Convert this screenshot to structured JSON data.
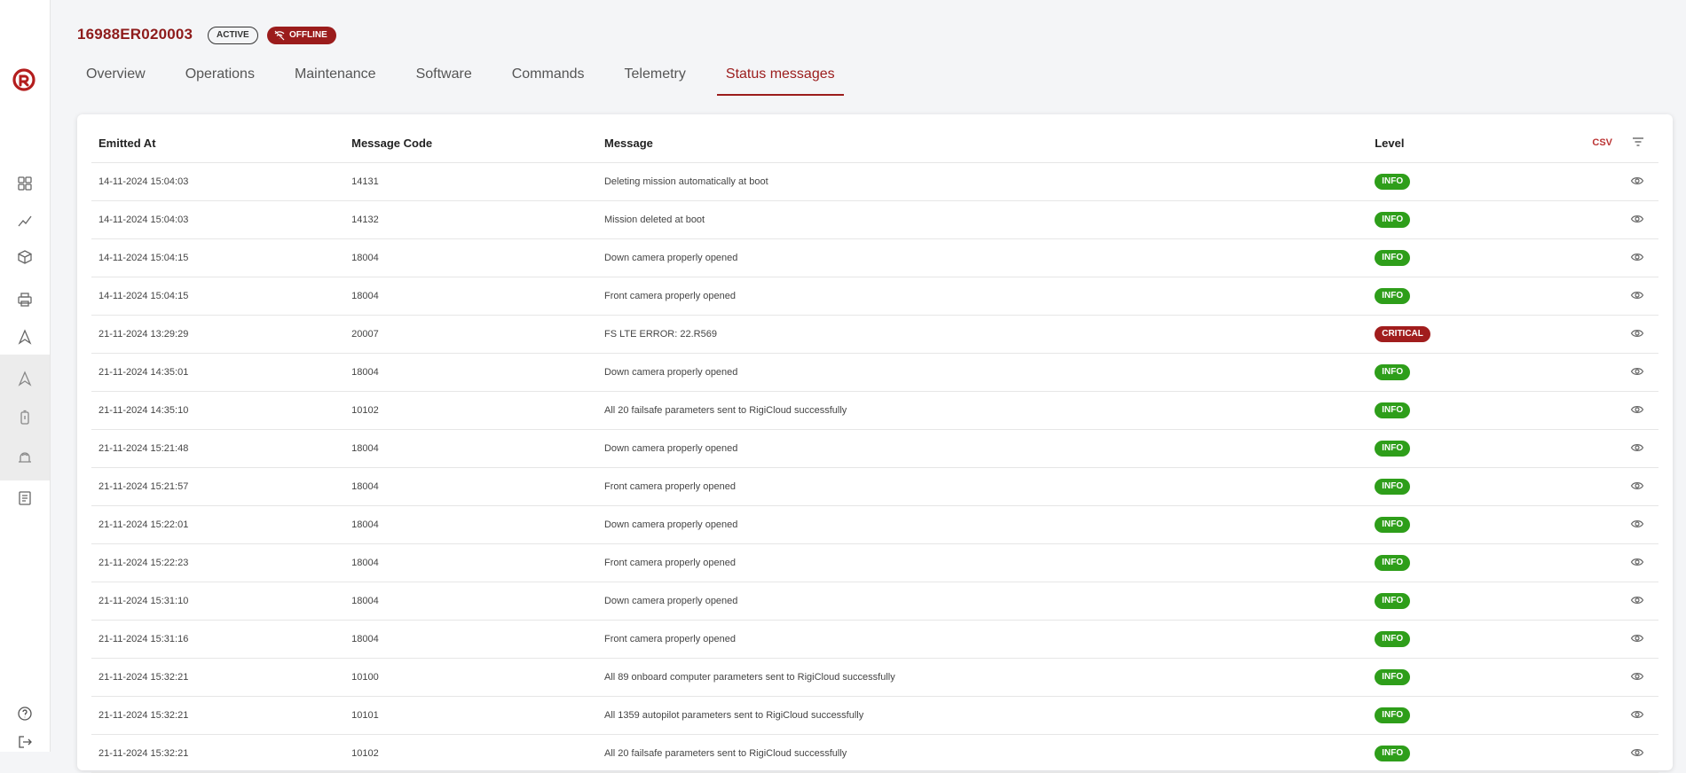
{
  "device": {
    "id": "16988ER020003",
    "status_badge": "ACTIVE",
    "connection_badge": "OFFLINE"
  },
  "tabs": [
    {
      "label": "Overview",
      "active": false
    },
    {
      "label": "Operations",
      "active": false
    },
    {
      "label": "Maintenance",
      "active": false
    },
    {
      "label": "Software",
      "active": false
    },
    {
      "label": "Commands",
      "active": false
    },
    {
      "label": "Telemetry",
      "active": false
    },
    {
      "label": "Status messages",
      "active": true
    }
  ],
  "table": {
    "columns": {
      "emitted_at": "Emitted At",
      "message_code": "Message Code",
      "message": "Message",
      "level": "Level",
      "csv": "CSV"
    },
    "rows": [
      {
        "at": "14-11-2024 15:04:03",
        "code": "14131",
        "msg": "Deleting mission automatically at boot",
        "level": "INFO"
      },
      {
        "at": "14-11-2024 15:04:03",
        "code": "14132",
        "msg": "Mission deleted at boot",
        "level": "INFO"
      },
      {
        "at": "14-11-2024 15:04:15",
        "code": "18004",
        "msg": "Down camera properly opened",
        "level": "INFO"
      },
      {
        "at": "14-11-2024 15:04:15",
        "code": "18004",
        "msg": "Front camera properly opened",
        "level": "INFO"
      },
      {
        "at": "21-11-2024 13:29:29",
        "code": "20007",
        "msg": "FS LTE ERROR: 22.R569",
        "level": "CRITICAL"
      },
      {
        "at": "21-11-2024 14:35:01",
        "code": "18004",
        "msg": "Down camera properly opened",
        "level": "INFO"
      },
      {
        "at": "21-11-2024 14:35:10",
        "code": "10102",
        "msg": "All 20 failsafe parameters sent to RigiCloud successfully",
        "level": "INFO"
      },
      {
        "at": "21-11-2024 15:21:48",
        "code": "18004",
        "msg": "Down camera properly opened",
        "level": "INFO"
      },
      {
        "at": "21-11-2024 15:21:57",
        "code": "18004",
        "msg": "Front camera properly opened",
        "level": "INFO"
      },
      {
        "at": "21-11-2024 15:22:01",
        "code": "18004",
        "msg": "Down camera properly opened",
        "level": "INFO"
      },
      {
        "at": "21-11-2024 15:22:23",
        "code": "18004",
        "msg": "Front camera properly opened",
        "level": "INFO"
      },
      {
        "at": "21-11-2024 15:31:10",
        "code": "18004",
        "msg": "Down camera properly opened",
        "level": "INFO"
      },
      {
        "at": "21-11-2024 15:31:16",
        "code": "18004",
        "msg": "Front camera properly opened",
        "level": "INFO"
      },
      {
        "at": "21-11-2024 15:32:21",
        "code": "10100",
        "msg": "All 89 onboard computer parameters sent to RigiCloud successfully",
        "level": "INFO"
      },
      {
        "at": "21-11-2024 15:32:21",
        "code": "10101",
        "msg": "All 1359 autopilot parameters sent to RigiCloud successfully",
        "level": "INFO"
      },
      {
        "at": "21-11-2024 15:32:21",
        "code": "10102",
        "msg": "All 20 failsafe parameters sent to RigiCloud successfully",
        "level": "INFO"
      }
    ]
  },
  "colors": {
    "brand": "#9b1c1c",
    "info": "#2e9e1a",
    "critical": "#a11d1d"
  },
  "sidebar_icons": [
    "grid-icon",
    "chart-line-icon",
    "cube-icon",
    "printer-icon",
    "drone-icon",
    "drone-alt-icon",
    "battery-icon",
    "dock-icon",
    "document-icon",
    "help-icon",
    "logout-icon"
  ]
}
